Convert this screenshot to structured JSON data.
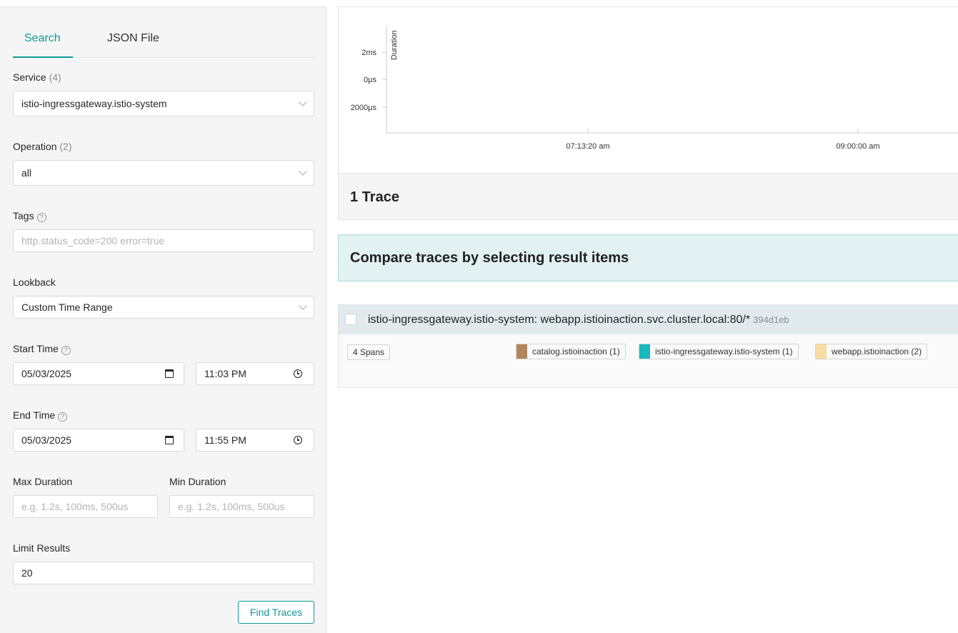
{
  "sidebar": {
    "tabs": [
      {
        "label": "Search",
        "active": true
      },
      {
        "label": "JSON File",
        "active": false
      }
    ],
    "service": {
      "label": "Service",
      "count": "(4)",
      "value": "istio-ingressgateway.istio-system"
    },
    "operation": {
      "label": "Operation",
      "count": "(2)",
      "value": "all"
    },
    "tags": {
      "label": "Tags",
      "help": "?",
      "placeholder": "http.status_code=200 error=true"
    },
    "lookback": {
      "label": "Lookback",
      "value": "Custom Time Range"
    },
    "start_time": {
      "label": "Start Time",
      "help": "?",
      "date": "05/03/2025",
      "time": "11:03 PM"
    },
    "end_time": {
      "label": "End Time",
      "help": "?",
      "date": "05/03/2025",
      "time": "11:55 PM"
    },
    "max_duration": {
      "label": "Max Duration",
      "placeholder": "e.g. 1.2s, 100ms, 500us"
    },
    "min_duration": {
      "label": "Min Duration",
      "placeholder": "e.g. 1.2s, 100ms, 500us"
    },
    "limit": {
      "label": "Limit Results",
      "value": "20"
    },
    "find_button": "Find Traces"
  },
  "chart_data": {
    "type": "scatter",
    "ylabel": "Duration",
    "y_ticks": [
      "2ms",
      "0µs",
      "2000µs"
    ],
    "x_ticks": [
      "07:13:20 am",
      "09:00:00 am"
    ],
    "points": []
  },
  "results": {
    "count_label": "1 Trace",
    "compare_label": "Compare traces by selecting result items",
    "trace": {
      "title": "istio-ingressgateway.istio-system: webapp.istioinaction.svc.cluster.local:80/*",
      "id": "394d1eb",
      "spans": "4 Spans",
      "services": [
        {
          "name": "catalog.istioinaction (1)",
          "color": "#b0875b"
        },
        {
          "name": "istio-ingressgateway.istio-system (1)",
          "color": "#17b8be"
        },
        {
          "name": "webapp.istioinaction (2)",
          "color": "#f8dca1"
        }
      ]
    }
  }
}
